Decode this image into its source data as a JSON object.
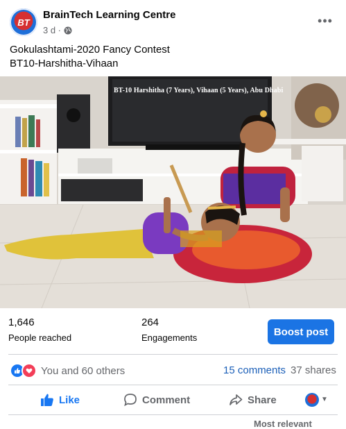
{
  "post": {
    "page_name": "BrainTech Learning Centre",
    "avatar_initials": "BT",
    "time": "3 d ·",
    "text_line1": "Gokulashtami-2020 Fancy Contest",
    "text_line2": "BT10-Harshitha-Vihaan",
    "more_label": "•••"
  },
  "photo": {
    "caption": "BT-10 Harshitha (7 Years), Vihaan (5 Years), Abu Dhabi"
  },
  "insights": {
    "reached_value": "1,646",
    "reached_label": "People reached",
    "engagements_value": "264",
    "engagements_label": "Engagements",
    "boost_label": "Boost post"
  },
  "reactions": {
    "text": "You and 60 others",
    "comments": "15 comments",
    "shares": "37 shares"
  },
  "actions": {
    "like": "Like",
    "comment": "Comment",
    "share": "Share"
  },
  "comments_sort": "Most relevant",
  "colors": {
    "accent": "#1b74e4",
    "like": "#1877f2",
    "love": "#f33e58",
    "muted": "#65676b"
  }
}
